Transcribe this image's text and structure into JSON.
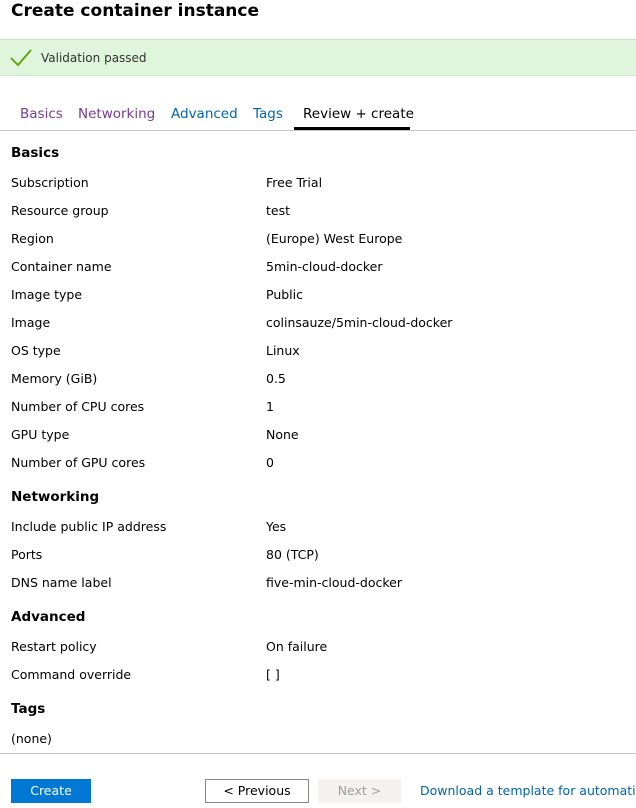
{
  "page": {
    "title": "Create container instance"
  },
  "banner": {
    "message": "Validation passed",
    "icon": "checkmark-icon",
    "color": "#57a300"
  },
  "tabs": [
    {
      "label": "Basics",
      "state": "visited"
    },
    {
      "label": "Networking",
      "state": "visited"
    },
    {
      "label": "Advanced",
      "state": "link"
    },
    {
      "label": "Tags",
      "state": "link"
    },
    {
      "label": "Review + create",
      "state": "active"
    }
  ],
  "sections": {
    "basics": {
      "heading": "Basics",
      "rows": [
        {
          "label": "Subscription",
          "value": "Free Trial"
        },
        {
          "label": "Resource group",
          "value": "test"
        },
        {
          "label": "Region",
          "value": "(Europe) West Europe"
        },
        {
          "label": "Container name",
          "value": "5min-cloud-docker"
        },
        {
          "label": "Image type",
          "value": "Public"
        },
        {
          "label": "Image",
          "value": "colinsauze/5min-cloud-docker"
        },
        {
          "label": "OS type",
          "value": "Linux"
        },
        {
          "label": "Memory (GiB)",
          "value": "0.5"
        },
        {
          "label": "Number of CPU cores",
          "value": "1"
        },
        {
          "label": "GPU type",
          "value": "None"
        },
        {
          "label": "Number of GPU cores",
          "value": "0"
        }
      ]
    },
    "networking": {
      "heading": "Networking",
      "rows": [
        {
          "label": "Include public IP address",
          "value": "Yes"
        },
        {
          "label": "Ports",
          "value": "80 (TCP)"
        },
        {
          "label": "DNS name label",
          "value": "five-min-cloud-docker"
        }
      ]
    },
    "advanced": {
      "heading": "Advanced",
      "rows": [
        {
          "label": "Restart policy",
          "value": "On failure"
        },
        {
          "label": "Command override",
          "value": "[ ]"
        }
      ]
    },
    "tags": {
      "heading": "Tags",
      "rows": [
        {
          "label": "(none)",
          "value": ""
        }
      ]
    }
  },
  "footer": {
    "create_label": "Create",
    "previous_label": "< Previous",
    "next_label": "Next >",
    "download_label": "Download a template for automation"
  },
  "colors": {
    "primary": "#0078d4",
    "link": "#0063b1",
    "visited": "#773b93",
    "success_bg": "#dff6dd"
  }
}
